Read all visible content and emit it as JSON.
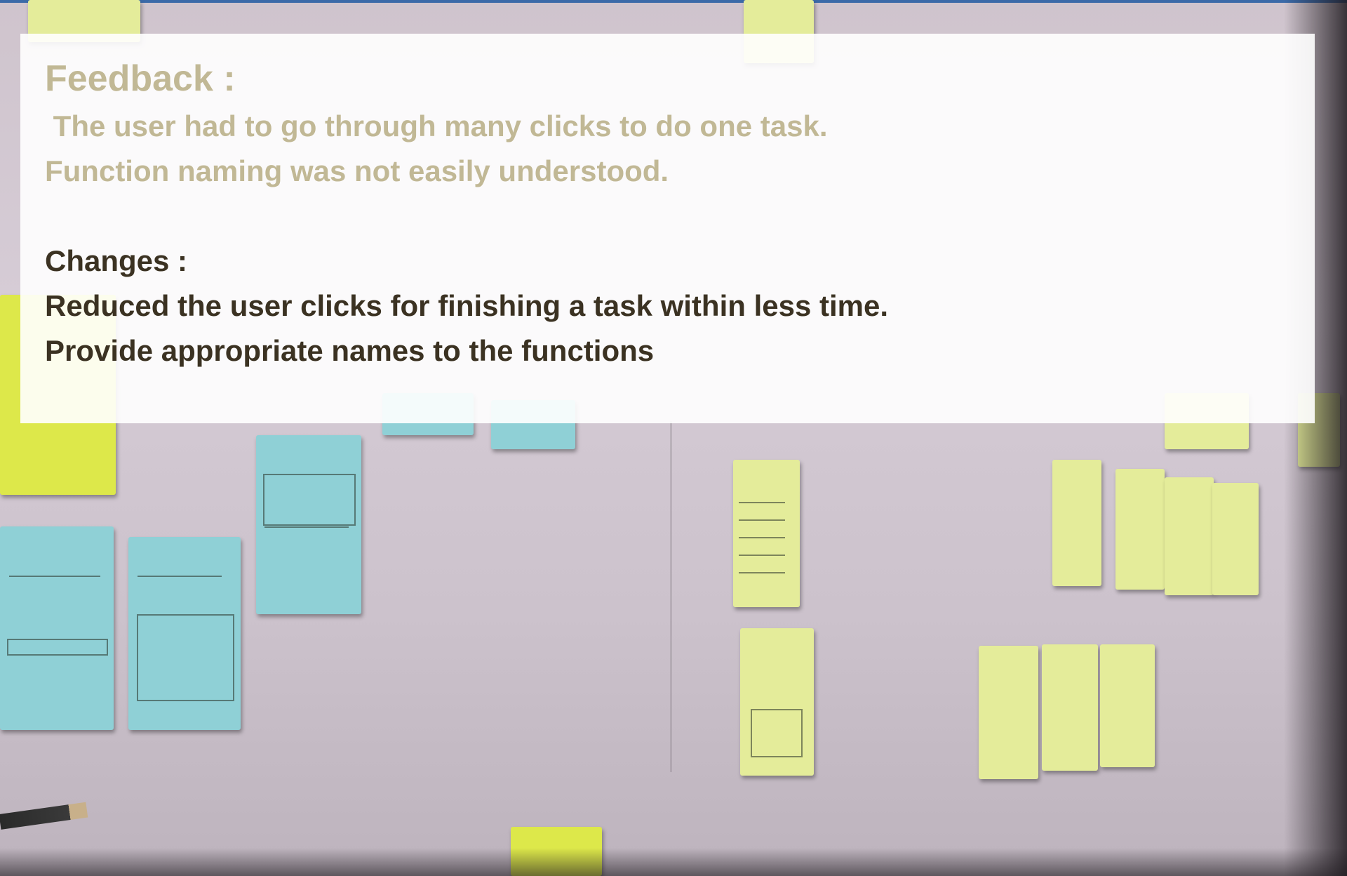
{
  "overlay": {
    "feedback_heading": "Feedback :",
    "feedback_lines": [
      " The user had to go through many clicks to do one task.",
      "Function naming was not easily understood."
    ],
    "changes_heading": "Changes :",
    "changes_lines": [
      "Reduced the user clicks for finishing a task within less time.",
      "Provide appropriate names to the functions"
    ]
  },
  "colors": {
    "feedback_text": "#c1b895",
    "changes_text": "#3b3222",
    "overlay_background": "#ffffff",
    "paper_background": "#d6ccd6",
    "blue_note": "#8fd0d6",
    "yellow_note": "#e4ec9a",
    "top_bar": "#3b6aa8"
  }
}
